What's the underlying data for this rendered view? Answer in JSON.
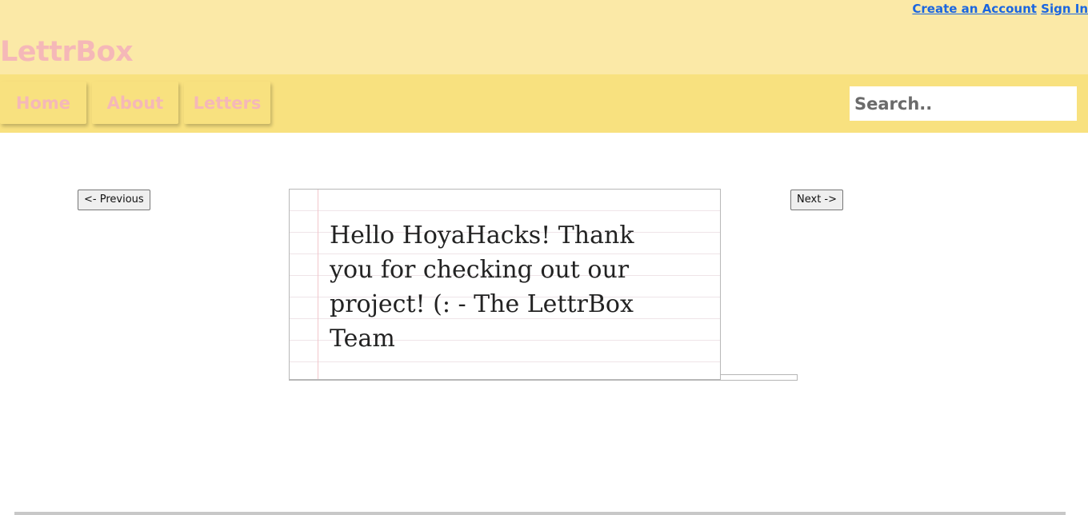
{
  "header": {
    "logo": "LettrBox",
    "auth": {
      "create_account": "Create an Account",
      "sign_in": "Sign In"
    }
  },
  "nav": {
    "items": [
      {
        "label": "Home"
      },
      {
        "label": "About"
      },
      {
        "label": "Letters"
      }
    ],
    "search": {
      "placeholder": "Search..",
      "value": ""
    }
  },
  "letter_view": {
    "previous_label": "<- Previous",
    "next_label": "Next ->",
    "letter_text": "Hello HoyaHacks! Thank you for checking out our project! (: - The LettrBox Team"
  },
  "colors": {
    "header_bg": "#fbe9a7",
    "nav_bg": "#f8e17f",
    "brand_pink": "#f5b8b8",
    "link_blue": "#1b66e0"
  }
}
